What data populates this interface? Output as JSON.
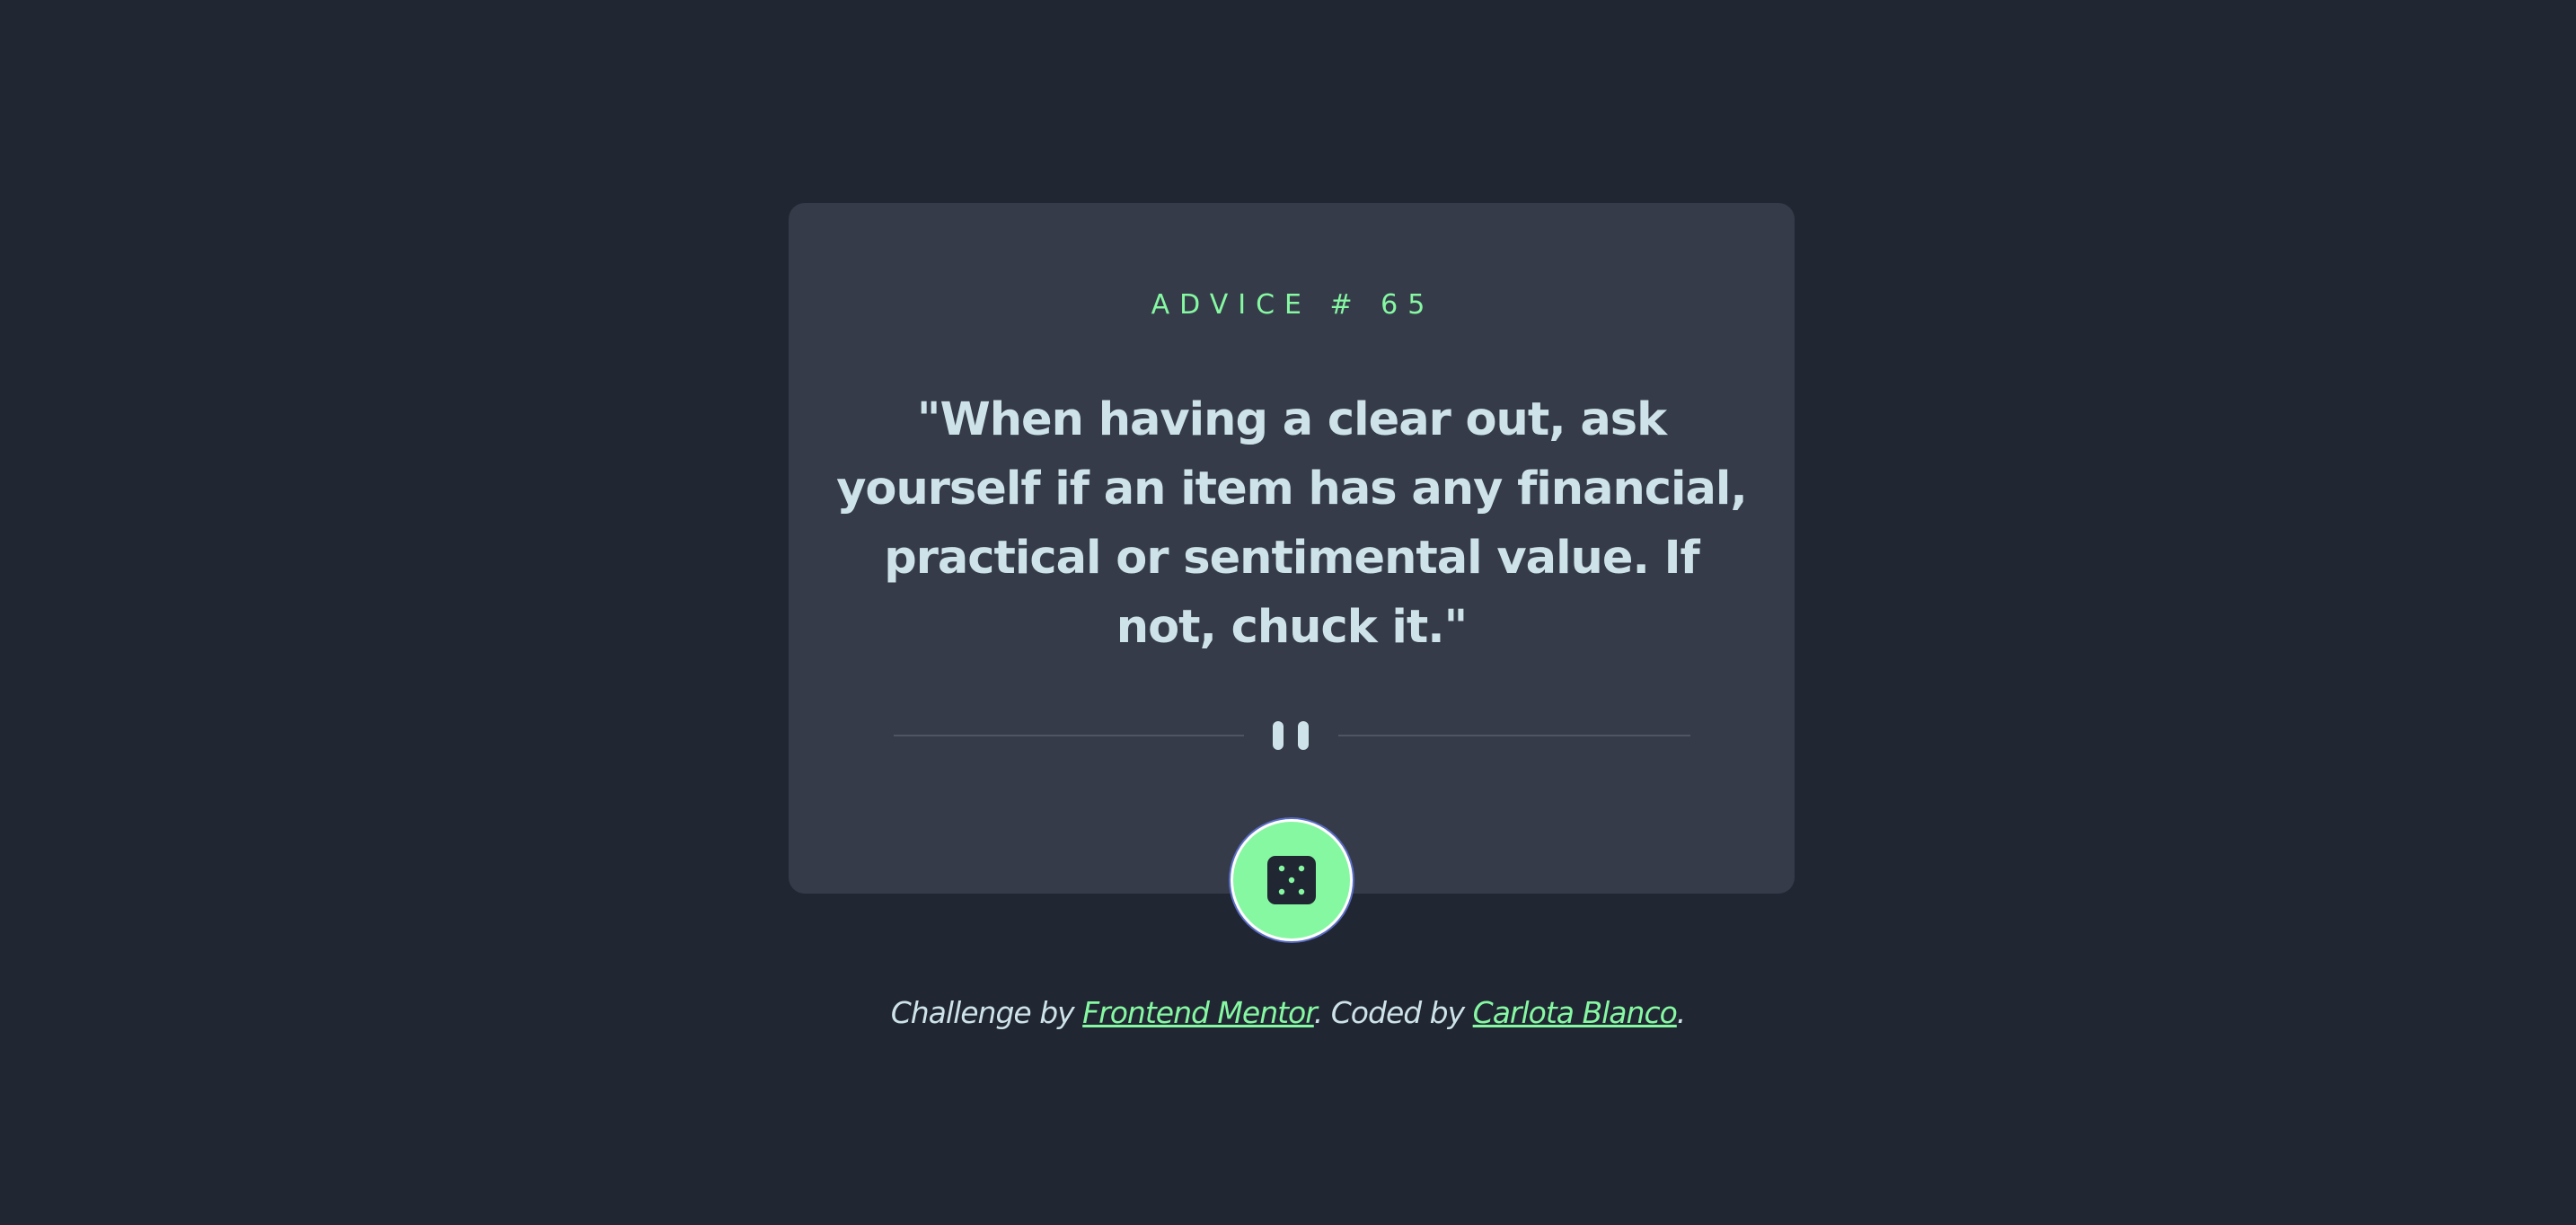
{
  "card": {
    "advice_label": "ADVICE # 65",
    "quote": "\"When having a clear out, ask yourself if an item has any financial, practical or sentimental value. If not, chuck it.\""
  },
  "icons": {
    "divider": "pause-icon",
    "button": "dice-icon"
  },
  "footer": {
    "prefix": "Challenge by ",
    "link1": "Frontend Mentor",
    "middle": ". Coded by ",
    "link2": "Carlota Blanco",
    "suffix": "."
  },
  "colors": {
    "background": "#202632",
    "card": "#353b49",
    "accent": "#86f8a2",
    "text": "#cee3e9",
    "divider": "#4e5563"
  }
}
